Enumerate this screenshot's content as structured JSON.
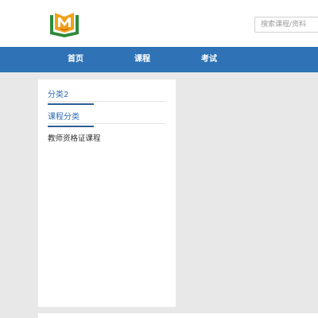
{
  "header": {
    "logo_icon": "book-shield-logo",
    "search": {
      "placeholder": "搜索课程/资料",
      "value": ""
    }
  },
  "nav": {
    "items": [
      {
        "label": "首页"
      },
      {
        "label": "课程"
      },
      {
        "label": "考试"
      }
    ]
  },
  "sidebar": {
    "categories": [
      {
        "label": "分类2"
      },
      {
        "label": "课程分类"
      }
    ],
    "courses": [
      {
        "label": "教师资格证课程"
      }
    ]
  },
  "colors": {
    "nav_bg": "#2f73b6",
    "link": "#2f6db0",
    "page_bg": "#e8e8e8"
  }
}
